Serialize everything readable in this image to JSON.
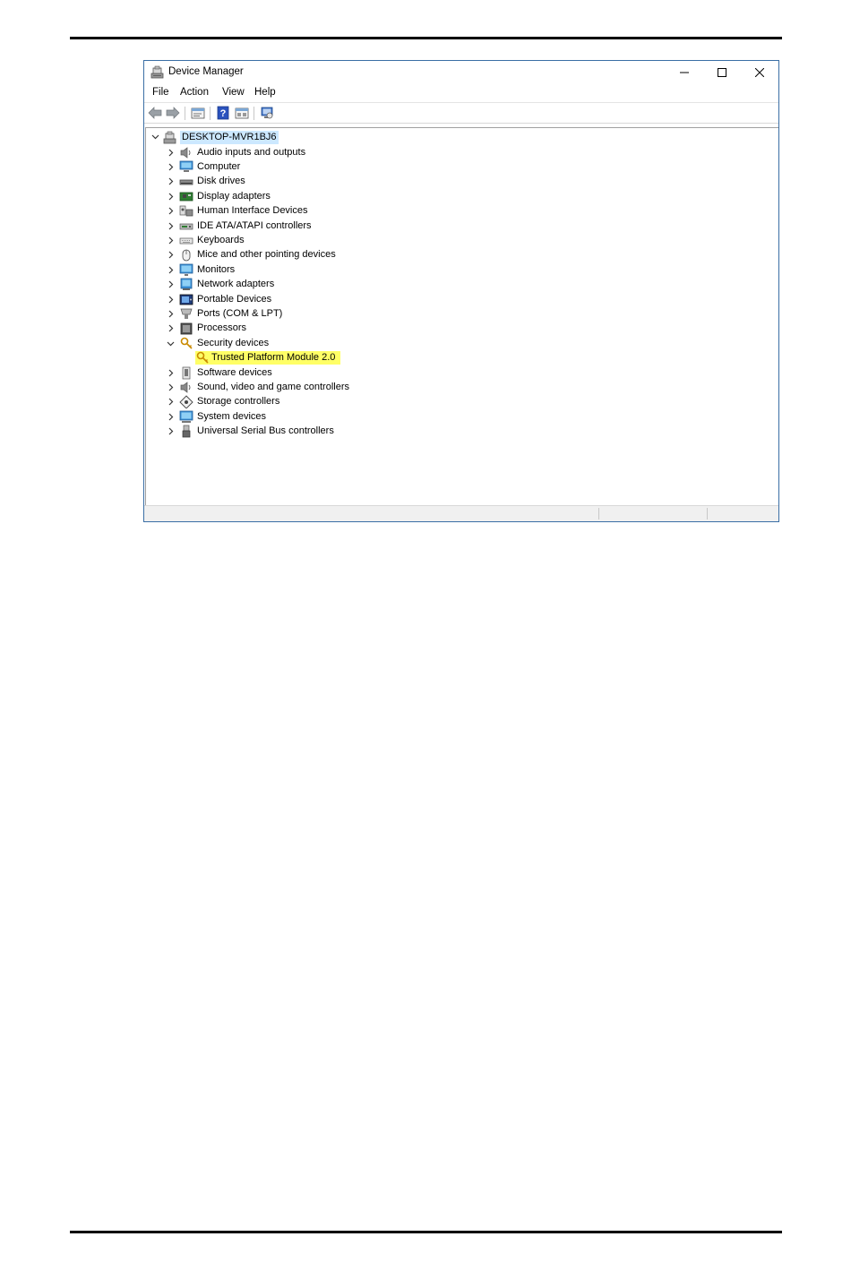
{
  "window": {
    "title": "Device Manager"
  },
  "menu": {
    "items": [
      "File",
      "Action",
      "View",
      "Help"
    ]
  },
  "toolbar": {
    "buttons": [
      "back-arrow-icon",
      "forward-arrow-icon",
      "properties-icon",
      "help-icon",
      "view-icon",
      "monitor-scan-icon"
    ]
  },
  "tree": {
    "root": "DESKTOP-MVR1BJ6",
    "categories": [
      {
        "label": "Audio inputs and outputs",
        "icon": "speaker-icon"
      },
      {
        "label": "Computer",
        "icon": "computer-icon"
      },
      {
        "label": "Disk drives",
        "icon": "disk-drive-icon"
      },
      {
        "label": "Display adapters",
        "icon": "display-adapter-icon"
      },
      {
        "label": "Human Interface Devices",
        "icon": "hid-icon"
      },
      {
        "label": "IDE ATA/ATAPI controllers",
        "icon": "ide-controller-icon"
      },
      {
        "label": "Keyboards",
        "icon": "keyboard-icon"
      },
      {
        "label": "Mice and other pointing devices",
        "icon": "mouse-icon"
      },
      {
        "label": "Monitors",
        "icon": "monitor-icon"
      },
      {
        "label": "Network adapters",
        "icon": "network-adapter-icon"
      },
      {
        "label": "Portable Devices",
        "icon": "portable-device-icon"
      },
      {
        "label": "Ports (COM & LPT)",
        "icon": "port-icon"
      },
      {
        "label": "Processors",
        "icon": "processor-icon"
      },
      {
        "label": "Security devices",
        "icon": "security-key-icon",
        "expanded": true
      },
      {
        "label": "Software devices",
        "icon": "software-device-icon"
      },
      {
        "label": "Sound, video and game controllers",
        "icon": "speaker-icon"
      },
      {
        "label": "Storage controllers",
        "icon": "storage-controller-icon"
      },
      {
        "label": "System devices",
        "icon": "system-device-icon"
      },
      {
        "label": "Universal Serial Bus controllers",
        "icon": "usb-icon"
      }
    ],
    "security_child": "Trusted Platform Module 2.0",
    "colors": {
      "root_selection": "#cce8ff",
      "highlight": "#ffff66"
    }
  }
}
